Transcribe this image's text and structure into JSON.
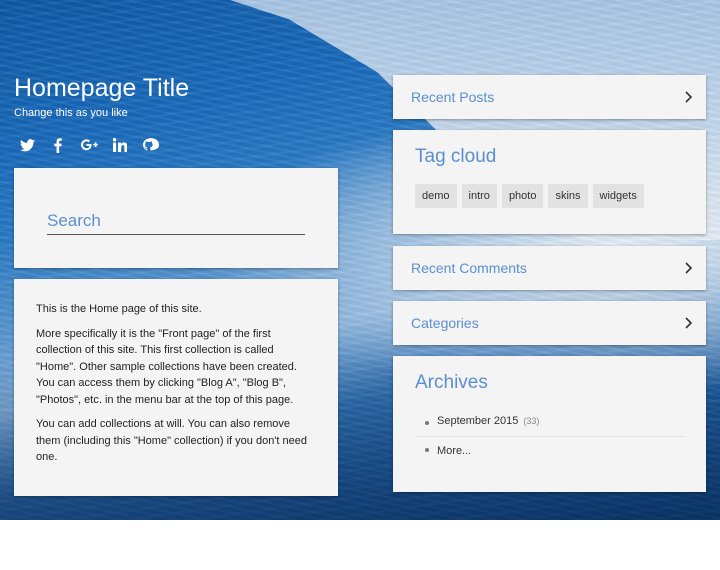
{
  "header": {
    "title": "Homepage Title",
    "tagline": "Change this as you like",
    "social_icons": [
      "twitter-icon",
      "facebook-icon",
      "google-plus-icon",
      "linkedin-icon",
      "github-icon"
    ]
  },
  "search": {
    "placeholder": "Search"
  },
  "content": {
    "paragraphs": [
      "This is the Home page of this site.",
      "More specifically it is the \"Front page\" of the first collection of this site. This first collection is called \"Home\". Other sample collections have been created. You can access them by clicking \"Blog A\", \"Blog B\", \"Photos\", etc. in the menu bar at the top of this page.",
      "You can add collections at will. You can also remove them (including this \"Home\" collection) if you don't need one."
    ]
  },
  "sidebar": {
    "recent_posts": {
      "title": "Recent Posts"
    },
    "tag_cloud": {
      "title": "Tag cloud",
      "tags": [
        "demo",
        "intro",
        "photo",
        "skins",
        "widgets"
      ]
    },
    "recent_comments": {
      "title": "Recent Comments"
    },
    "categories": {
      "title": "Categories"
    },
    "archives": {
      "title": "Archives",
      "items": [
        {
          "label": "September 2015",
          "count": "(33)"
        },
        {
          "label": "More...",
          "count": ""
        }
      ]
    }
  },
  "colors": {
    "accent": "#5a8fd0",
    "card_bg": "#f4f4f4",
    "tag_bg": "#e2e2e2"
  }
}
